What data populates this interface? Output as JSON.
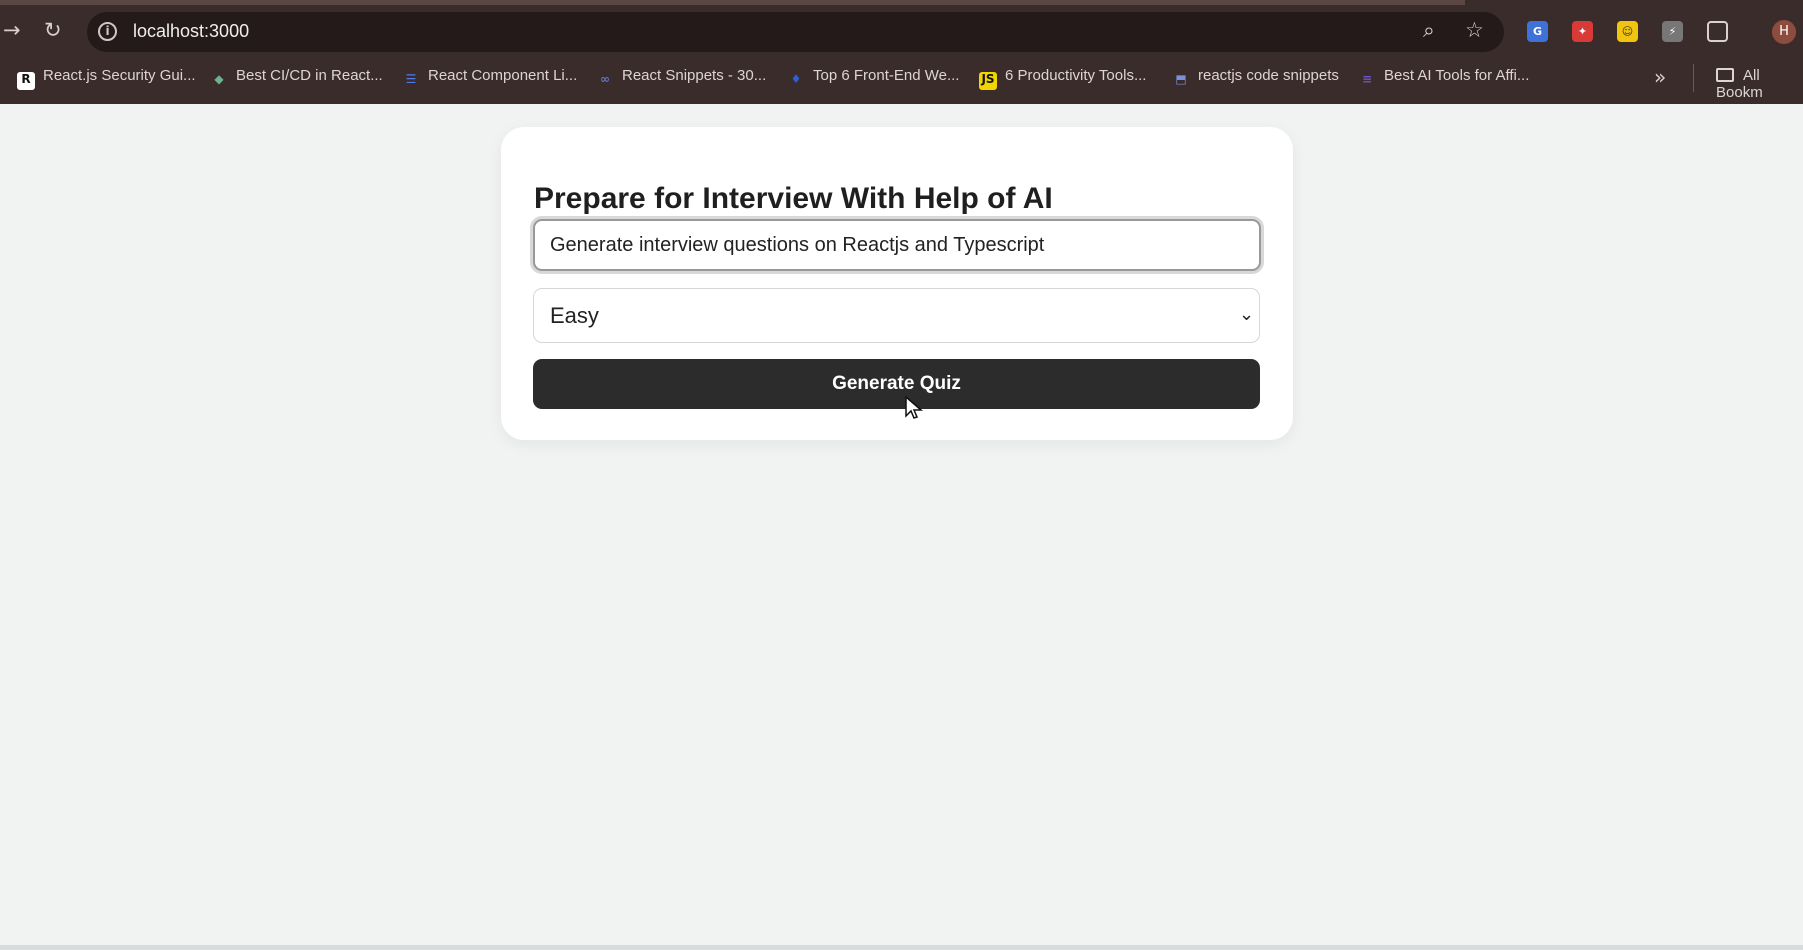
{
  "browser": {
    "address": "localhost:3000",
    "bookmarks": [
      {
        "label": "React.js Security Gui...",
        "icon": "R",
        "color": "#111111"
      },
      {
        "label": "Best CI/CD in React...",
        "icon": "◆",
        "color": "#6db28d"
      },
      {
        "label": "React Component Li...",
        "icon": "☰",
        "color": "#4f7be8"
      },
      {
        "label": "React Snippets - 30...",
        "icon": "∞",
        "color": "#5c78c8"
      },
      {
        "label": "Top 6 Front-End We...",
        "icon": "♦",
        "color": "#2f5fd8"
      },
      {
        "label": "6 Productivity Tools...",
        "icon": "JS",
        "color": "#f1d400"
      },
      {
        "label": "reactjs code snippets",
        "icon": "⬒",
        "color": "#7a90d8"
      },
      {
        "label": "Best AI Tools for Affi...",
        "icon": "≡",
        "color": "#6d55c8"
      }
    ],
    "all_bookmarks": "All Bookm",
    "profile_initial": "H"
  },
  "app": {
    "title": "Prepare for Interview With Help of AI",
    "prompt_value": "Generate interview questions on Reactjs and Typescript",
    "difficulty": "Easy",
    "button_label": "Generate Quiz"
  }
}
